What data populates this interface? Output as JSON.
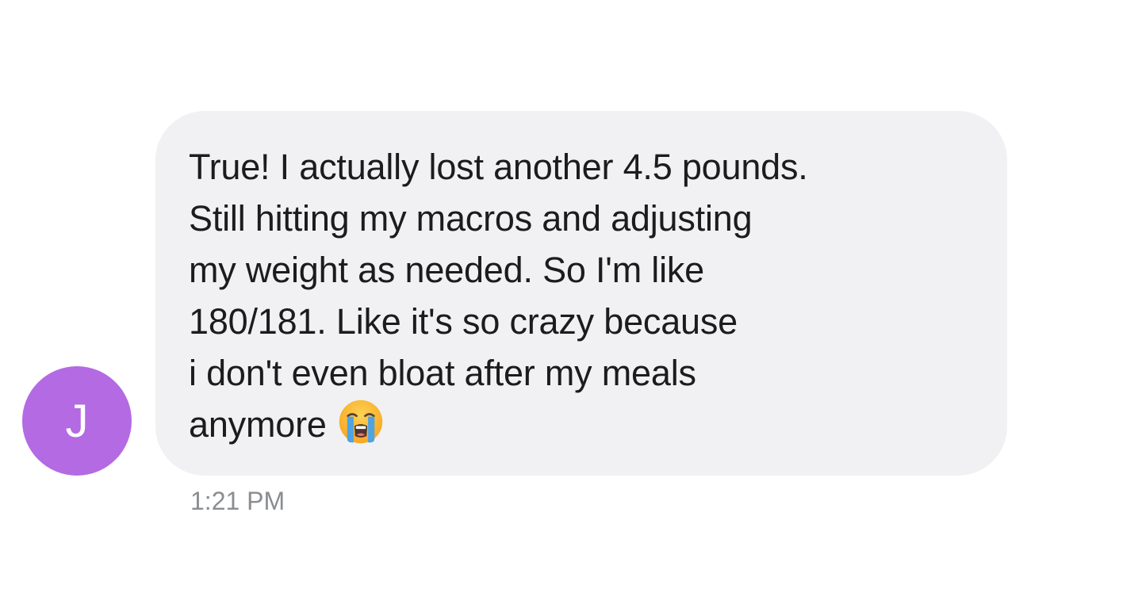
{
  "contact": {
    "avatar_letter": "J",
    "avatar_color": "#b36ae2"
  },
  "message": {
    "lines": [
      "True! I actually lost another 4.5 pounds.",
      "Still hitting my macros and adjusting",
      "my weight as needed. So I'm like",
      "180/181. Like it's so crazy because",
      "i don't even bloat after my meals",
      "anymore"
    ],
    "emoji": "loudly-crying-face-icon",
    "bubble_color": "#f1f1f4",
    "timestamp": "1:21 PM"
  }
}
